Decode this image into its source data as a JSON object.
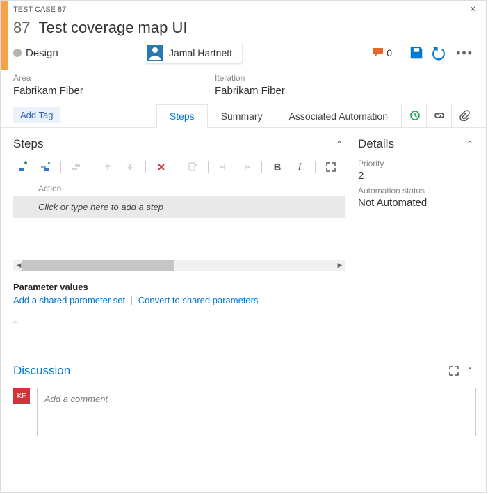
{
  "header": {
    "type_label": "TEST CASE 87",
    "id": "87",
    "title": "Test coverage map UI",
    "state": "Design",
    "assignee": "Jamal Hartnett",
    "comment_count": "0"
  },
  "classification": {
    "area_label": "Area",
    "area_value": "Fabrikam Fiber",
    "iteration_label": "Iteration",
    "iteration_value": "Fabrikam Fiber"
  },
  "controls": {
    "add_tag": "Add Tag"
  },
  "tabs": {
    "steps": "Steps",
    "summary": "Summary",
    "automation": "Associated Automation"
  },
  "steps": {
    "section_title": "Steps",
    "column_action": "Action",
    "placeholder": "Click or type here to add a step",
    "param_header": "Parameter values",
    "link_add_shared": "Add a shared parameter set",
    "link_convert": "Convert to shared parameters"
  },
  "details": {
    "section_title": "Details",
    "priority_label": "Priority",
    "priority_value": "2",
    "automation_label": "Automation status",
    "automation_value": "Not Automated"
  },
  "discussion": {
    "title": "Discussion",
    "avatar_initials": "KF",
    "placeholder": "Add a comment"
  }
}
